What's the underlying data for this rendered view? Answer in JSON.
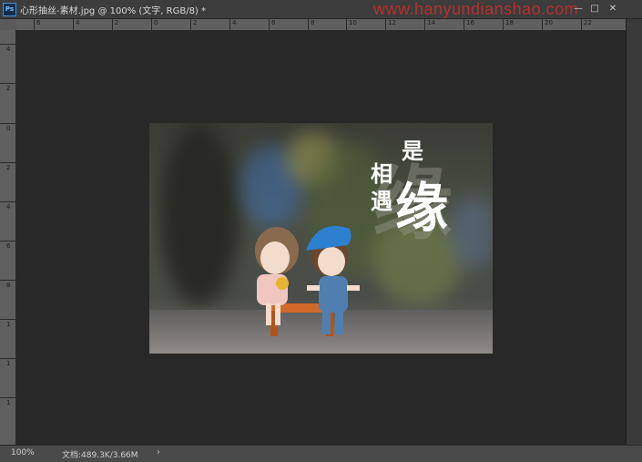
{
  "window": {
    "title": "心形抽丝-素材.jpg @ 100% (文字, RGB/8) *",
    "app_icon": "Ps",
    "watermark": "www.hanyundianshao.com",
    "controls": {
      "minimize": "—",
      "maximize": "□",
      "close": "✕"
    }
  },
  "rulers": {
    "horizontal": [
      "6",
      "4",
      "2",
      "0",
      "2",
      "4",
      "6",
      "8",
      "10",
      "12",
      "14",
      "16",
      "18",
      "20",
      "22"
    ],
    "vertical": [
      "4",
      "2",
      "0",
      "2",
      "4",
      "6",
      "8",
      "1",
      "1",
      "1"
    ]
  },
  "image_text": {
    "shi": "是",
    "xiang": "相",
    "yu": "遇",
    "yuan": "缘",
    "yuan_shadow": "缘"
  },
  "statusbar": {
    "zoom": "100%",
    "doc_info": "文档:489.3K/3.66M",
    "arrow": "›"
  }
}
